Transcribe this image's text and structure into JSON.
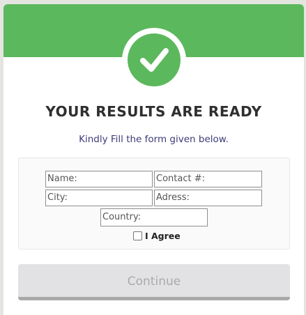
{
  "header": {
    "accent_color": "#5cb85c",
    "icon": "checkmark-icon"
  },
  "title": "YOUR RESULTS ARE READY",
  "subtitle": "Kindly Fill the form given below.",
  "form": {
    "name_placeholder": "Name:",
    "contact_placeholder": "Contact #:",
    "city_placeholder": "City:",
    "adress_placeholder": "Adress:",
    "country_placeholder": "Country:",
    "agree_label": "I Agree",
    "agree_checked": false
  },
  "continue_label": "Continue"
}
